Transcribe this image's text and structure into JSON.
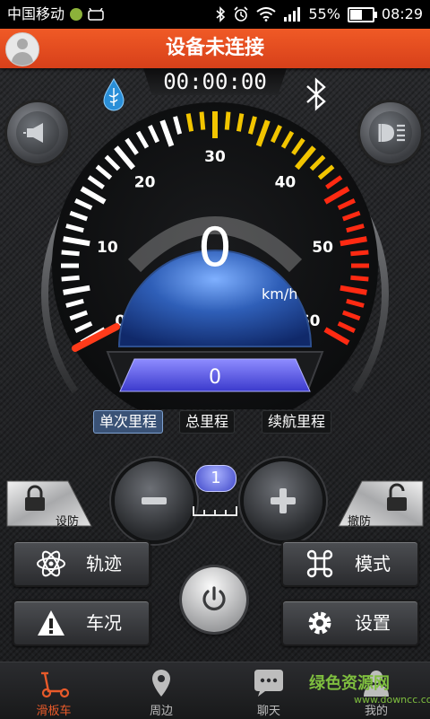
{
  "status_bar": {
    "carrier": "中国移动",
    "battery": "55%",
    "time": "08:29",
    "battery_level": 0.55
  },
  "header": {
    "title": "设备未连接",
    "avatar_icon": "user-avatar-icon"
  },
  "timer": "00:00:00",
  "gauge": {
    "speed": "0",
    "unit": "km/h",
    "ticks": [
      "0",
      "10",
      "20",
      "30",
      "40",
      "50",
      "60"
    ],
    "trip_value": "0",
    "accent_color": "#2f6fc8"
  },
  "mileage_tabs": [
    {
      "label": "单次里程",
      "active": true
    },
    {
      "label": "总里程",
      "active": false
    },
    {
      "label": "续航里程",
      "active": false
    }
  ],
  "controls": {
    "lock_label": "设防",
    "unlock_label": "撤防",
    "level": "1"
  },
  "buttons": {
    "track": "轨迹",
    "mode": "模式",
    "status": "车况",
    "settings": "设置"
  },
  "nav": [
    {
      "label": "滑板车",
      "icon": "scooter-icon",
      "active": true
    },
    {
      "label": "周边",
      "icon": "location-pin-icon",
      "active": false
    },
    {
      "label": "聊天",
      "icon": "chat-bubble-icon",
      "active": false
    },
    {
      "label": "我的",
      "icon": "user-icon",
      "active": false
    }
  ],
  "watermark": {
    "text": "绿色资源网",
    "url": "www.downcc.com"
  }
}
